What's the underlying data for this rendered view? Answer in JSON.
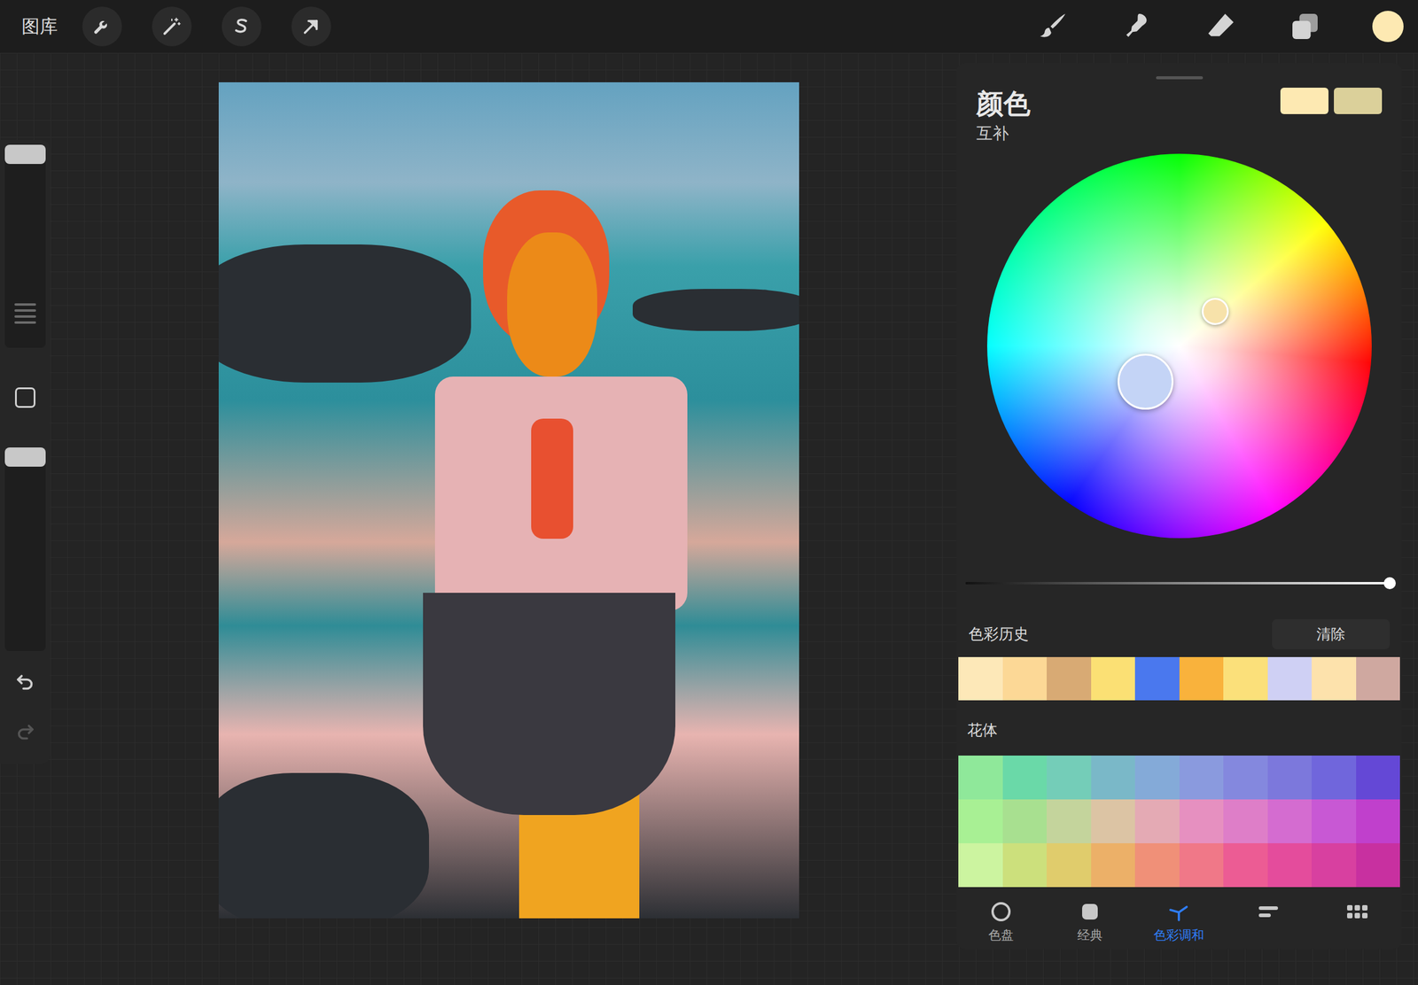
{
  "top_bar": {
    "gallery": "图库"
  },
  "sidebar": {
    "size_level": 1,
    "opacity_level": 1,
    "redo_disabled": true
  },
  "color_panel": {
    "title": "颜色",
    "mode": "互补",
    "current_color": "#fde9b2",
    "secondary_color": "#dbd09a",
    "harmony_points": [
      {
        "color": "#f7e2aa"
      },
      {
        "color": "#c4d4f6"
      }
    ],
    "brightness_level": 1
  },
  "history": {
    "label": "色彩历史",
    "clear": "清除",
    "swatches": [
      "#fde8b8",
      "#fcd896",
      "#d8aa74",
      "#fbe074",
      "#4a78ee",
      "#f9b23c",
      "#fbe07a",
      "#cfd0f4",
      "#fde2ac",
      "#cfa8a0"
    ]
  },
  "palette": {
    "name": "花体",
    "rows": [
      [
        "#8fe89a",
        "#6ad9a8",
        "#74cdb8",
        "#7ab8c8",
        "#84aad8",
        "#8a9ade",
        "#8488de",
        "#7c78dc",
        "#7066dc",
        "#6448d6"
      ],
      [
        "#a8f094",
        "#a8e090",
        "#c4d49c",
        "#dcc4a4",
        "#e4aab4",
        "#e690c0",
        "#de7ec8",
        "#d46cd0",
        "#c858d4",
        "#c040cc"
      ],
      [
        "#ccf4a0",
        "#cce07c",
        "#e0cc6c",
        "#ecb068",
        "#f09078",
        "#f07888",
        "#ec5c94",
        "#e44c9c",
        "#d840a0",
        "#c830a0"
      ]
    ]
  },
  "tabs": [
    {
      "label": "色盘",
      "selected": false
    },
    {
      "label": "经典",
      "selected": false
    },
    {
      "label": "色彩调和",
      "selected": true
    },
    {
      "selected": false
    },
    {
      "selected": false
    }
  ]
}
